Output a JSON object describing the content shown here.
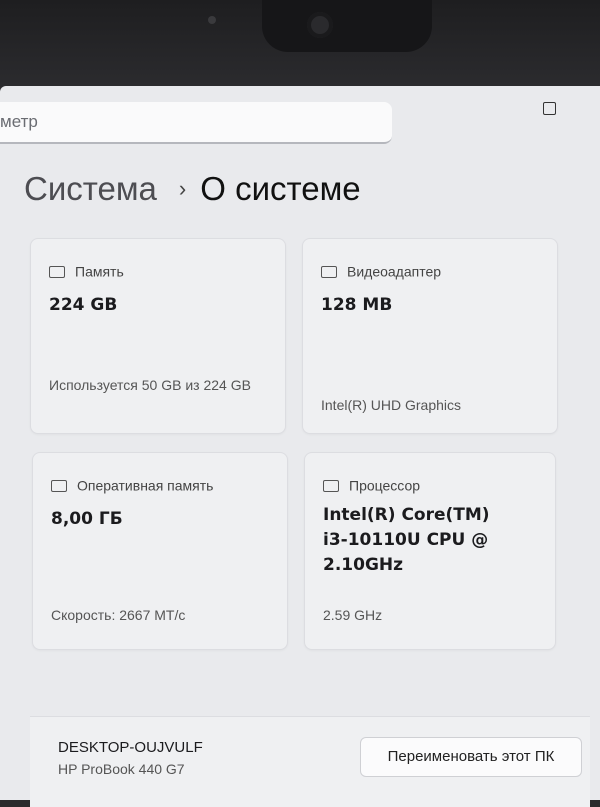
{
  "search": {
    "text": "метр"
  },
  "breadcrumb": {
    "parent": "Система",
    "current": "О системе"
  },
  "cards": {
    "storage": {
      "title": "Память",
      "value": "224 GB",
      "detail": "Используется 50 GB из 224 GB",
      "icon": "storage-icon"
    },
    "gpu": {
      "title": "Видеоадаптер",
      "value": "128 MB",
      "detail": "Intel(R) UHD Graphics",
      "icon": "display-adapter-icon"
    },
    "ram": {
      "title": "Оперативная память",
      "value": "8,00 ГБ",
      "detail": "Скорость: 2667 МТ/с",
      "icon": "memory-icon"
    },
    "cpu": {
      "title": "Процессор",
      "value": "Intel(R) Core(TM) i3-10110U CPU @ 2.10GHz",
      "detail": "2.59 GHz",
      "icon": "processor-icon"
    }
  },
  "device": {
    "name": "DESKTOP-OUJVULF",
    "model": "HP ProBook 440 G7",
    "rename_label": "Переименовать этот ПК"
  }
}
